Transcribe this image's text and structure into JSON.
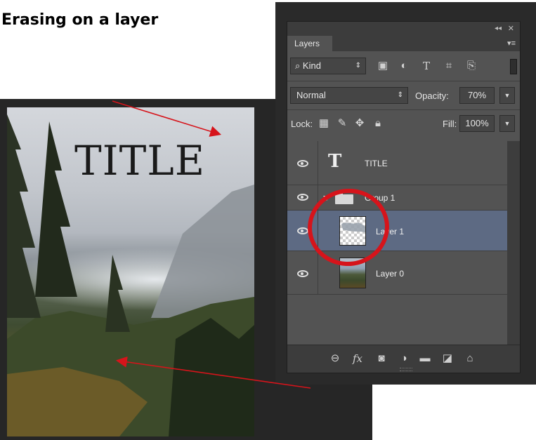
{
  "heading": ". Erasing on a layer",
  "photo": {
    "title_text": "TITLE"
  },
  "panel": {
    "tab_label": "Layers",
    "collapse_glyph": "◂◂",
    "close_glyph": "✕",
    "menu_glyph": "▾≡",
    "filter": {
      "kind_label": "Kind",
      "kind_glyph": "⌕",
      "updown": "⇕"
    },
    "blend_mode": "Normal",
    "opacity_label": "Opacity:",
    "opacity_value": "70%",
    "lock_label": "Lock:",
    "fill_label": "Fill:",
    "fill_value": "100%",
    "dropdown_glyph": "▼",
    "layers": [
      {
        "name": "TITLE",
        "kind": "text",
        "visible": true,
        "selected": false
      },
      {
        "name": "Group 1",
        "kind": "group",
        "visible": true,
        "selected": false,
        "expanded": true
      },
      {
        "name": "Layer 1",
        "kind": "pixel-transparent",
        "visible": true,
        "selected": true
      },
      {
        "name": "Layer 0",
        "kind": "pixel-photo",
        "visible": true,
        "selected": false
      }
    ],
    "bottom_icons": [
      "link-layers-icon",
      "fx-icon",
      "mask-icon",
      "adjustment-icon",
      "new-group-icon",
      "new-layer-icon",
      "trash-icon"
    ],
    "fx_label": "fx"
  },
  "colors": {
    "panel_bg": "#535353",
    "selected_row": "#5d6a83",
    "annotation_red": "#d6141b"
  }
}
